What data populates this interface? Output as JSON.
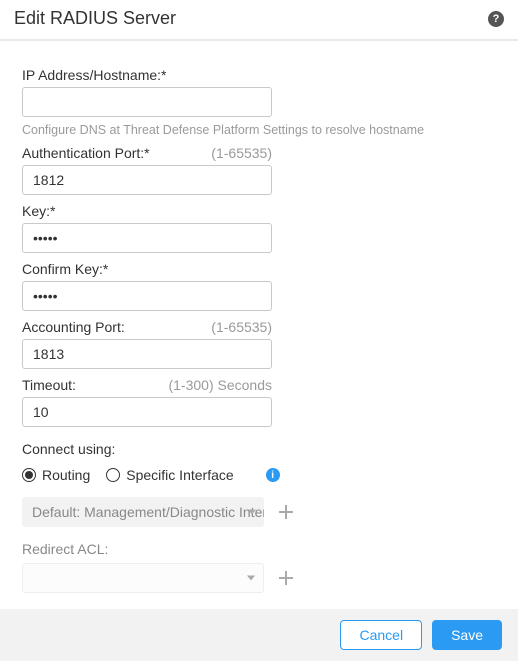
{
  "header": {
    "title": "Edit RADIUS Server"
  },
  "fields": {
    "ip_hostname": {
      "label": "IP Address/Hostname:*",
      "value": "",
      "helper": "Configure DNS at Threat Defense Platform Settings to resolve hostname"
    },
    "auth_port": {
      "label": "Authentication Port:*",
      "hint": "(1-65535)",
      "value": "1812"
    },
    "key": {
      "label": "Key:*",
      "value": "•••••"
    },
    "confirm_key": {
      "label": "Confirm Key:*",
      "value": "•••••"
    },
    "acct_port": {
      "label": "Accounting Port:",
      "hint": "(1-65535)",
      "value": "1813"
    },
    "timeout": {
      "label": "Timeout:",
      "hint": "(1-300) Seconds",
      "value": "10"
    }
  },
  "connect": {
    "label": "Connect using:",
    "options": {
      "routing": "Routing",
      "specific": "Specific Interface"
    },
    "selected": "routing",
    "interface_dropdown": "Default: Management/Diagnostic Interface"
  },
  "redirect": {
    "label": "Redirect ACL:",
    "value": ""
  },
  "footer": {
    "cancel": "Cancel",
    "save": "Save"
  }
}
